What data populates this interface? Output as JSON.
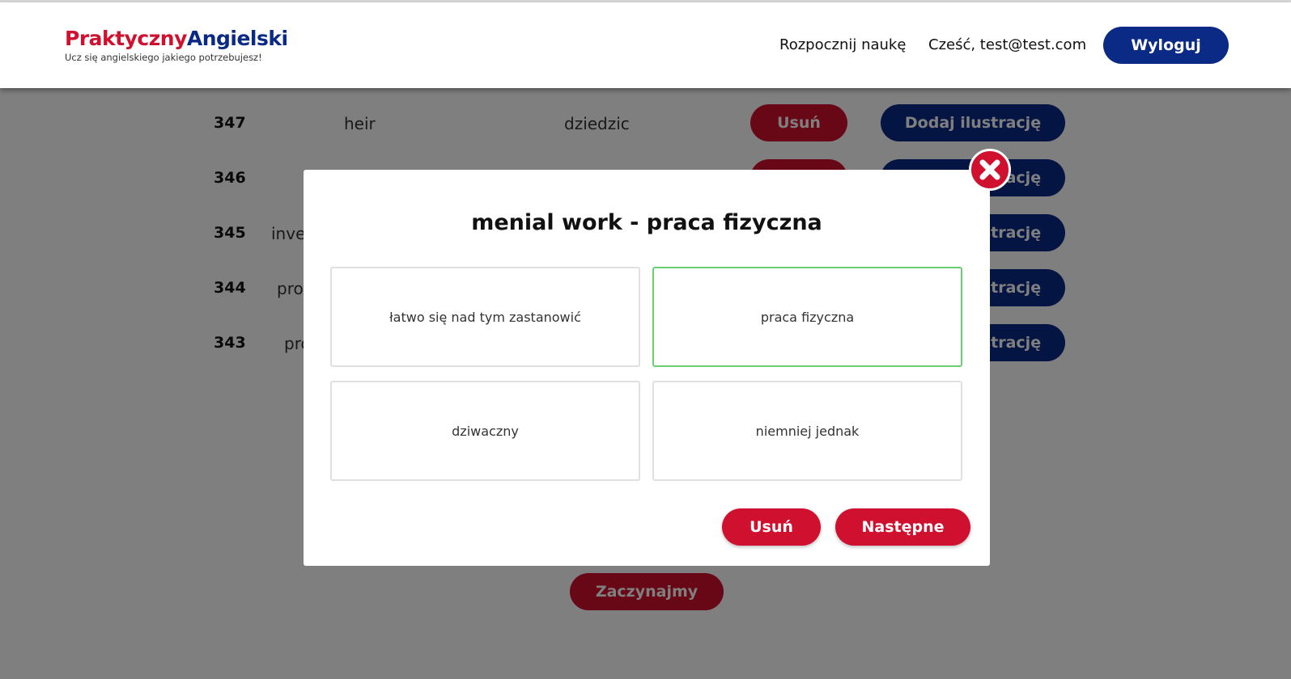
{
  "header": {
    "logo_part1": "Praktyczny",
    "logo_part2": "Angielski",
    "tagline": "Ucz się angielskiego jakiego potrzebujesz!",
    "nav_learn": "Rozpocznij naukę",
    "greeting": "Cześć, test@test.com",
    "logout_label": "Wyloguj"
  },
  "words": [
    {
      "id": "347",
      "en": "heir",
      "pl": "dziedzic"
    },
    {
      "id": "346",
      "en": "",
      "pl": ""
    },
    {
      "id": "345",
      "en": "inve",
      "pl": ""
    },
    {
      "id": "344",
      "en": "pro",
      "pl": ""
    },
    {
      "id": "343",
      "en": "pro",
      "pl": ""
    }
  ],
  "row_buttons": {
    "delete_label": "Usuń",
    "illustration_label": "Dodaj ilustrację"
  },
  "start_label": "Zaczynajmy",
  "modal": {
    "title": "menial work - praca fizyczna",
    "options": [
      "łatwo się nad tym zastanowić",
      "praca fizyczna",
      "dziwaczny",
      "niemniej jednak"
    ],
    "delete_label": "Usuń",
    "next_label": "Następne",
    "close_icon": "close-icon"
  },
  "colors": {
    "brand_red": "#d0102f",
    "brand_blue": "#0b2a86",
    "correct_border": "#6ccf72",
    "overlay": "rgba(0,0,0,0.5)"
  }
}
